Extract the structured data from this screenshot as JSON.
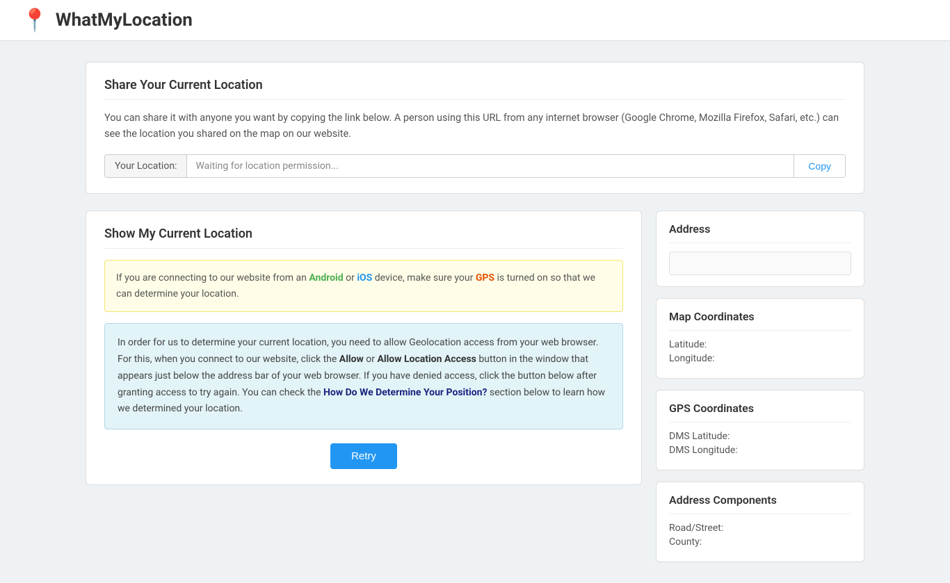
{
  "header": {
    "logo_icon": "📍",
    "title": "WhatMyLocation"
  },
  "share_card": {
    "heading": "Share Your Current Location",
    "description": "You can share it with anyone you want by copying the link below. A person using this URL from any internet browser (Google Chrome, Mozilla Firefox, Safari, etc.) can see the location you shared on the map on our website.",
    "location_label": "Your Location:",
    "location_placeholder": "Waiting for location permission...",
    "copy_button_label": "Copy"
  },
  "show_location_card": {
    "heading": "Show My Current Location",
    "warning_box": {
      "prefix": "If you are connecting to our website from an ",
      "android": "Android",
      "middle1": " or ",
      "ios": "iOS",
      "middle2": " device, make sure your ",
      "gps": "GPS",
      "suffix": " is turned on so that we can determine your location."
    },
    "info_box": {
      "part1": "In order for us to determine your current location, you need to allow Geolocation access from your web browser. For this, when you connect to our website, click the ",
      "allow1": "Allow",
      "part2": " or ",
      "allow2": "Allow Location Access",
      "part3": " button in the window that appears just below the address bar of your web browser. If you have denied access, click the button below after granting access to try again. You can check the ",
      "how_det": "How Do We Determine Your Position?",
      "part4": " section below to learn how we determined your location."
    },
    "retry_button_label": "Retry"
  },
  "address_card": {
    "heading": "Address",
    "value": ""
  },
  "map_coordinates_card": {
    "heading": "Map Coordinates",
    "latitude_label": "Latitude:",
    "longitude_label": "Longitude:",
    "latitude_value": "",
    "longitude_value": ""
  },
  "gps_coordinates_card": {
    "heading": "GPS Coordinates",
    "dms_latitude_label": "DMS Latitude:",
    "dms_longitude_label": "DMS Longitude:",
    "dms_latitude_value": "",
    "dms_longitude_value": ""
  },
  "address_components_card": {
    "heading": "Address Components",
    "road_label": "Road/Street:",
    "county_label": "County:",
    "road_value": "",
    "county_value": ""
  }
}
